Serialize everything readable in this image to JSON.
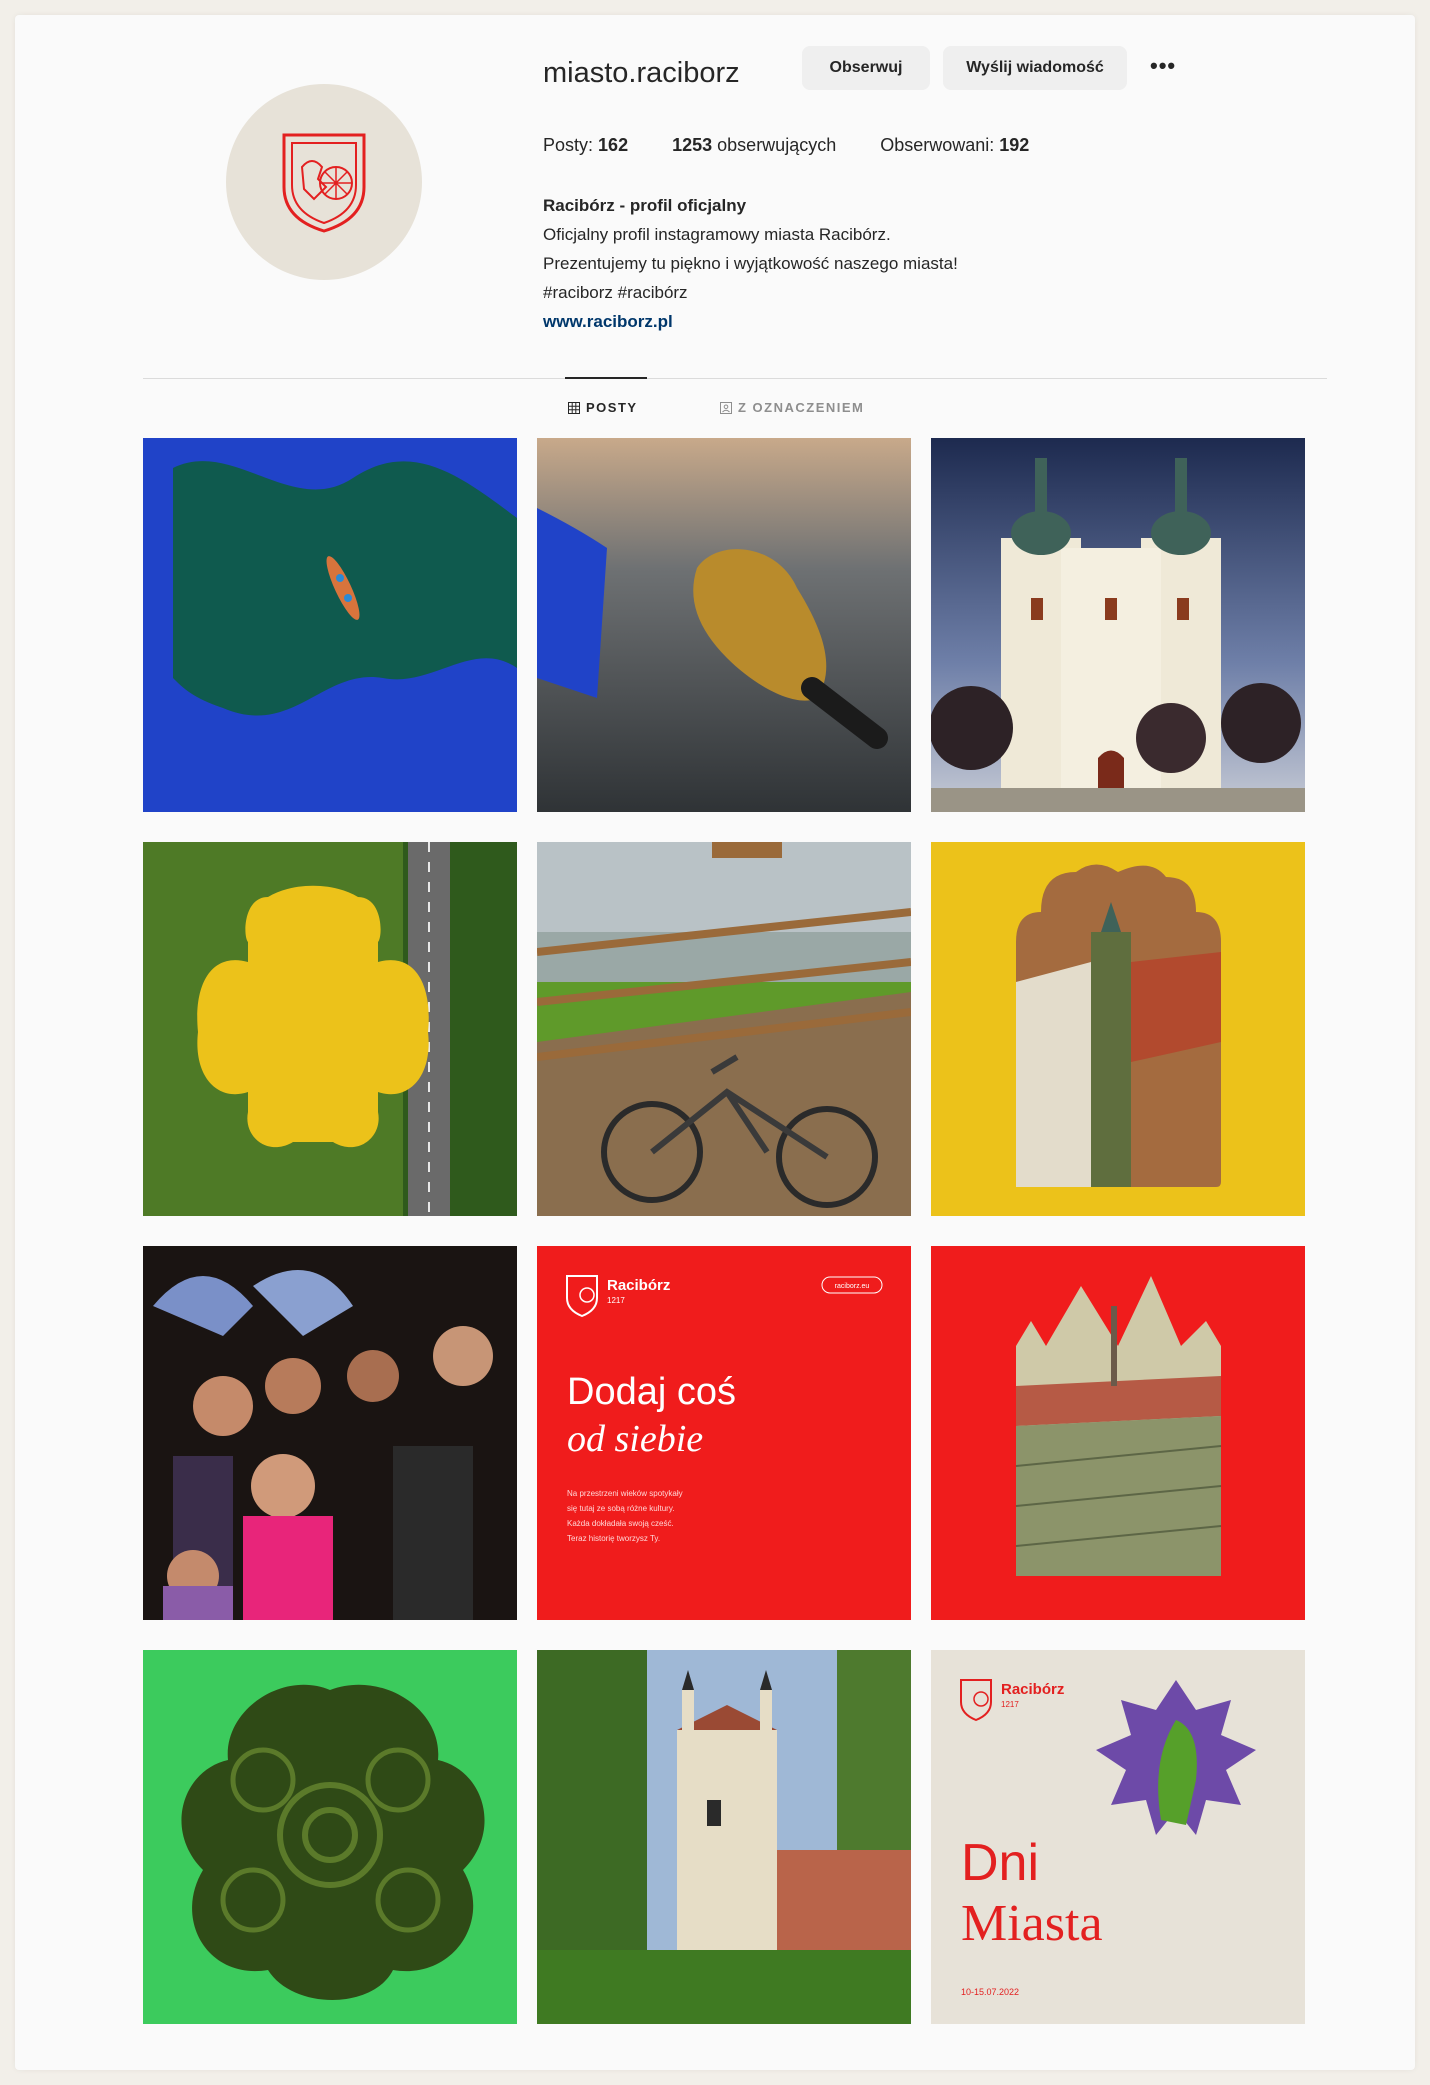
{
  "profile": {
    "username": "miasto.raciborz",
    "follow_label": "Obserwuj",
    "message_label": "Wyślij wiadomość",
    "more_label": "•••",
    "posts_label": "Posty:",
    "posts_count": "162",
    "followers_count": "1253",
    "followers_label": "obserwujących",
    "following_label": "Obserwowani:",
    "following_count": "192",
    "display_name": "Racibórz - profil oficjalny",
    "bio_line1": "Oficjalny profil instagramowy miasta Racibórz.",
    "bio_line2": "Prezentujemy tu piękno i wyjątkowość naszego miasta!",
    "bio_line3": "#raciborz #racibórz",
    "website": "www.raciborz.pl"
  },
  "tabs": {
    "posts": "POSTY",
    "tagged": "Z OZNACZENIEM"
  },
  "posts": {
    "p8": {
      "brand": "Racibórz",
      "brand_sub": "1217",
      "site": "raciborz.eu",
      "heading1": "Dodaj coś",
      "heading2": "od siebie",
      "body1": "Na przestrzeni wieków spotykały",
      "body2": "się tutaj ze sobą różne kultury.",
      "body3": "Każda dokładała swoją cześć.",
      "body4": "Teraz historię tworzysz Ty."
    },
    "p12": {
      "brand": "Racibórz",
      "brand_sub": "1217",
      "title1": "Dni",
      "title2": "Miasta",
      "date": "10-15.07.2022"
    }
  },
  "colors": {
    "brand_red": "#f01c1c",
    "brand_blue": "#2043c8",
    "brand_yellow": "#ecc21a",
    "brand_green": "#3ccb5d",
    "link": "#00376b"
  }
}
